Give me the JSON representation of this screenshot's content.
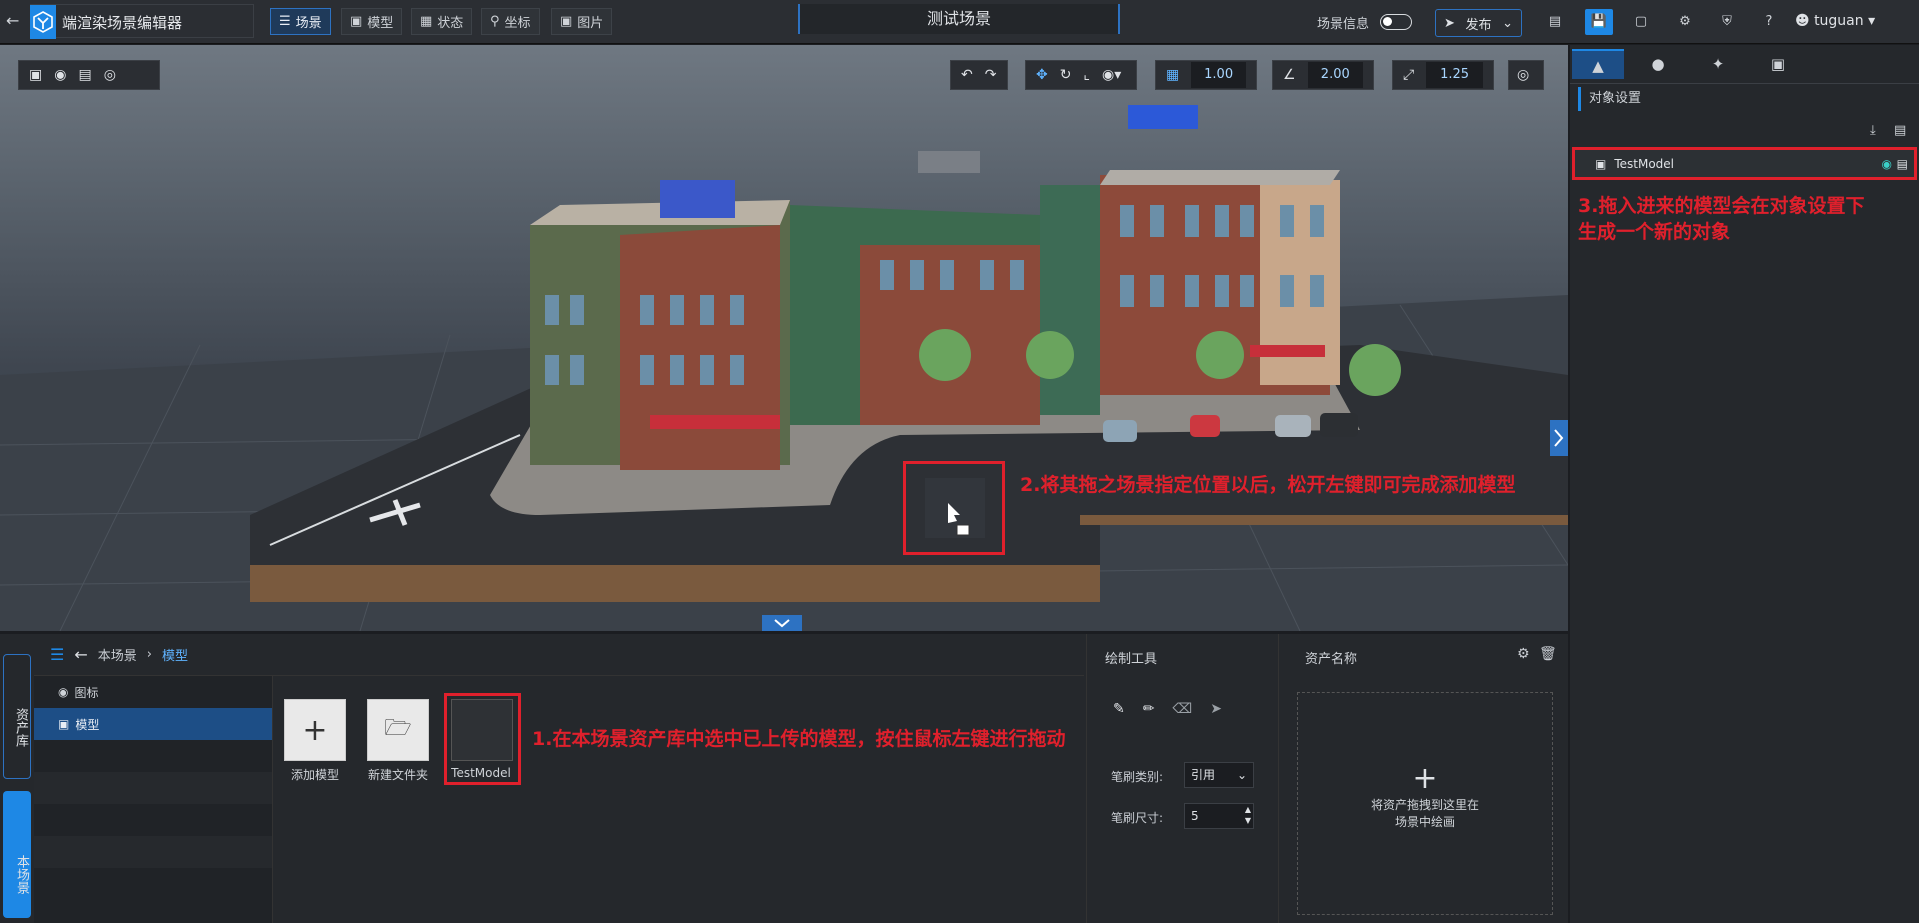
{
  "app": {
    "title": "端渲染场景编辑器",
    "scene_name": "测试场景"
  },
  "mode_tabs": [
    {
      "label": "场景",
      "active": true
    },
    {
      "label": "模型",
      "active": false
    },
    {
      "label": "状态",
      "active": false
    },
    {
      "label": "坐标",
      "active": false
    },
    {
      "label": "图片",
      "active": false
    }
  ],
  "header": {
    "scene_info_label": "场景信息",
    "publish_label": "发布",
    "user": "tuguan"
  },
  "viewport": {
    "grid_value": "1.00",
    "angle_value": "2.00",
    "scale_value": "1.25"
  },
  "right_panel": {
    "section_title": "对象设置",
    "object_name": "TestModel"
  },
  "annotations": {
    "step1": "1.在本场景资产库中选中已上传的模型，按住鼠标左键进行拖动",
    "step2": "2.将其拖之场景指定位置以后，松开左键即可完成添加模型",
    "step3_line1": "3.拖入进来的模型会在对象设置下",
    "step3_line2": "生成一个新的对象"
  },
  "bottom": {
    "side_tabs": [
      "资产库",
      "本场景"
    ],
    "breadcrumb_root": "本场景",
    "breadcrumb_current": "模型",
    "tree": [
      "图标",
      "模型"
    ],
    "cards": [
      "添加模型",
      "新建文件夹",
      "TestModel"
    ],
    "draw_tools": {
      "title": "绘制工具",
      "brush_type_label": "笔刷类别:",
      "brush_type_value": "引用",
      "brush_size_label": "笔刷尺寸:",
      "brush_size_value": "5"
    },
    "asset_panel": {
      "title": "资产名称",
      "drop_hint_line1": "将资产拖拽到这里在",
      "drop_hint_line2": "场景中绘画"
    }
  },
  "colors": {
    "accent": "#1e88e5",
    "annotation": "#e0202c"
  }
}
